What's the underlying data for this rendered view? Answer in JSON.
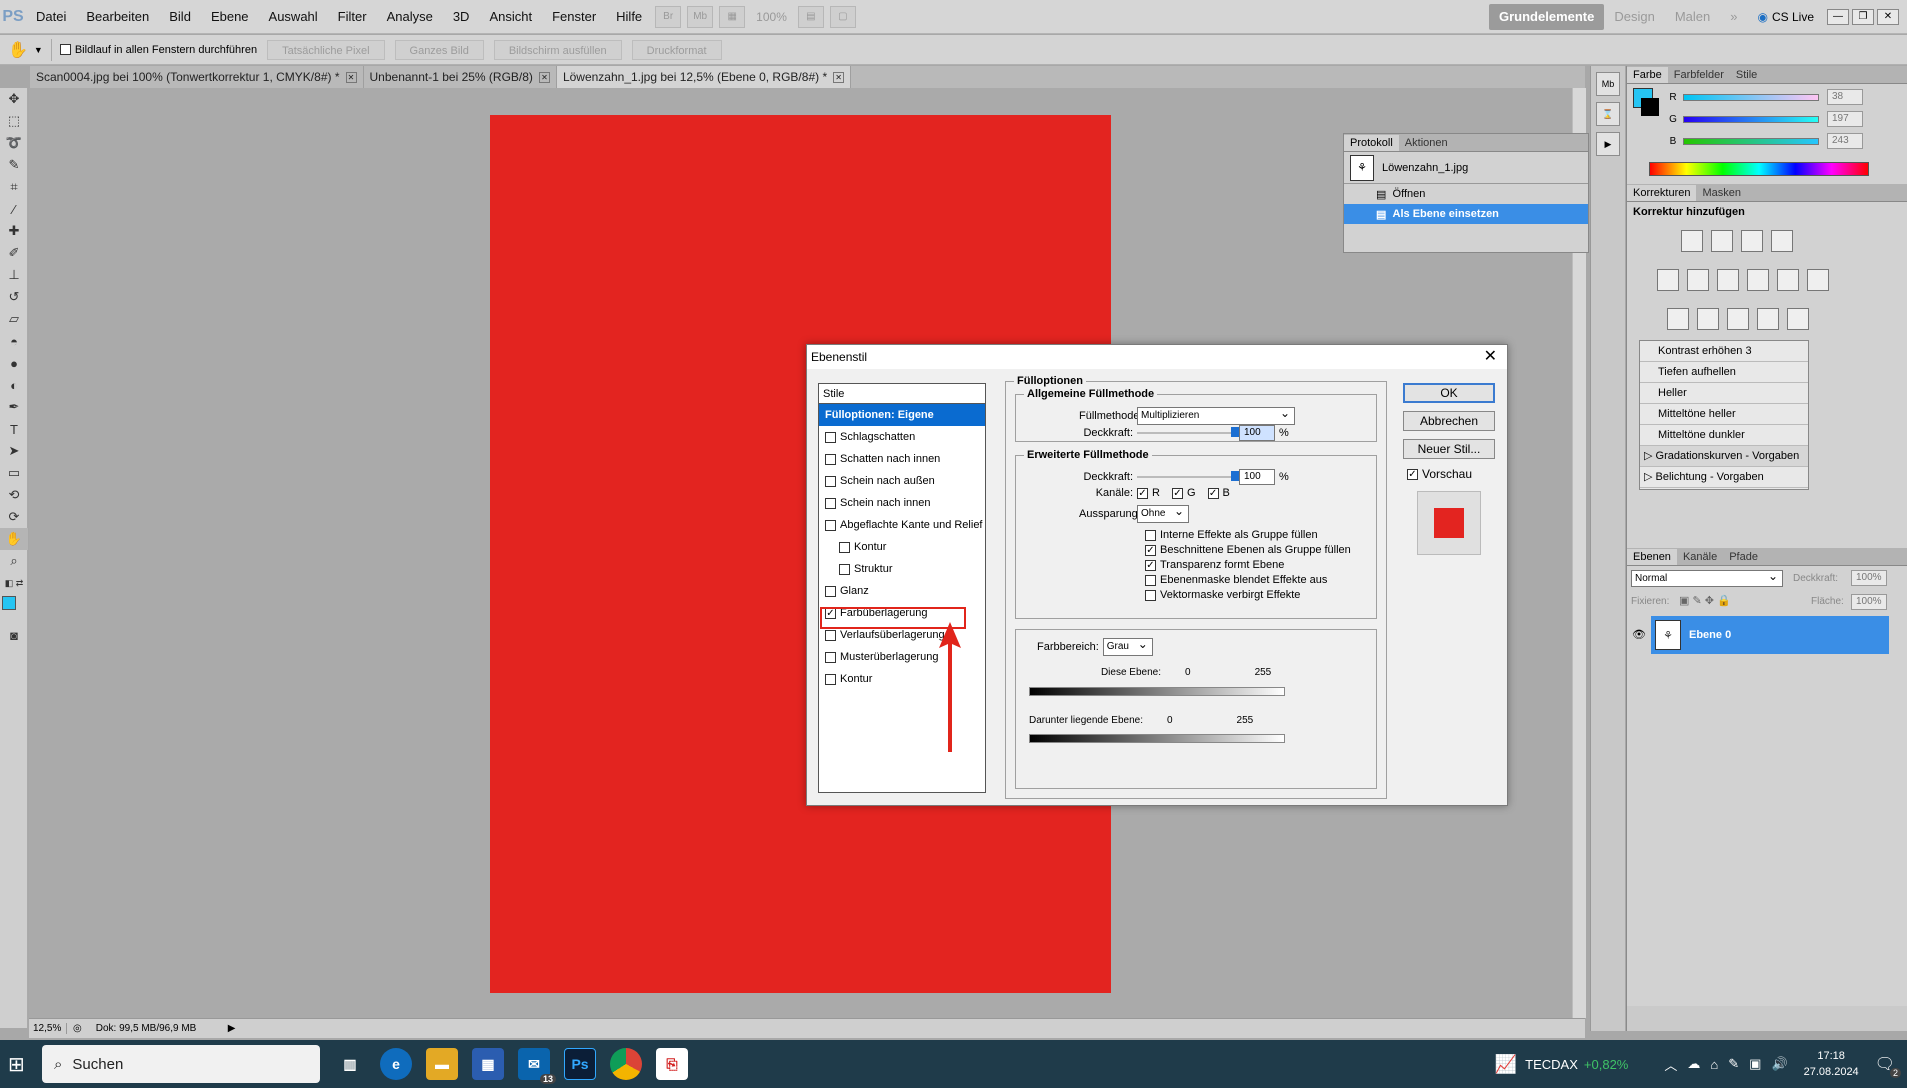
{
  "menubar": {
    "logo": "PS",
    "items": [
      "Datei",
      "Bearbeiten",
      "Bild",
      "Ebene",
      "Auswahl",
      "Filter",
      "Analyse",
      "3D",
      "Ansicht",
      "Fenster",
      "Hilfe"
    ],
    "bridge_labels": [
      "Br",
      "Mb"
    ],
    "zoom": "100%",
    "workspaces": [
      "Grundelemente",
      "Design",
      "Malen"
    ],
    "more": "»",
    "cslive": "CS Live"
  },
  "options": {
    "scroll_all_label": "Bildlauf in allen Fenstern durchführen",
    "buttons": [
      "Tatsächliche Pixel",
      "Ganzes Bild",
      "Bildschirm ausfüllen",
      "Druckformat"
    ]
  },
  "tabs": [
    {
      "label": "Scan0004.jpg bei 100% (Tonwertkorrektur 1, CMYK/8#) *",
      "active": false
    },
    {
      "label": "Unbenannt-1 bei 25% (RGB/8)",
      "active": false
    },
    {
      "label": "Löwenzahn_1.jpg bei 12,5% (Ebene 0, RGB/8#) *",
      "active": true
    }
  ],
  "document": {
    "fill_color": "#e32420"
  },
  "status": {
    "zoom": "12,5%",
    "doc_info": "Dok: 99,5 MB/96,9 MB"
  },
  "history": {
    "tabs": [
      "Protokoll",
      "Aktionen"
    ],
    "snapshot": "Löwenzahn_1.jpg",
    "items": [
      {
        "label": "Öffnen",
        "selected": false
      },
      {
        "label": "Als Ebene einsetzen",
        "selected": true
      }
    ]
  },
  "color_panel": {
    "tabs": [
      "Farbe",
      "Farbfelder",
      "Stile"
    ],
    "channels": [
      {
        "label": "R",
        "value": "38"
      },
      {
        "label": "G",
        "value": "197"
      },
      {
        "label": "B",
        "value": "243"
      }
    ],
    "fg_color": "#26c5f3"
  },
  "adjust_panel": {
    "tabs": [
      "Korrekturen",
      "Masken"
    ],
    "title": "Korrektur hinzufügen",
    "presets": [
      "Kontrast erhöhen 3",
      "Tiefen aufhellen",
      "Heller",
      "Mitteltöne heller",
      "Mitteltöne dunkler",
      "Gradationskurven - Vorgaben",
      "Belichtung - Vorgaben"
    ]
  },
  "layers_panel": {
    "tabs": [
      "Ebenen",
      "Kanäle",
      "Pfade"
    ],
    "blend": "Normal",
    "opacity_label": "Deckkraft:",
    "opacity": "100%",
    "lock_label": "Fixieren:",
    "fill_label": "Fläche:",
    "fill": "100%",
    "layer_name": "Ebene 0"
  },
  "dialog": {
    "title": "Ebenenstil",
    "close": "✕",
    "styles_header": "Stile",
    "styles": [
      {
        "label": "Fülloptionen: Eigene",
        "selected": true,
        "checkbox": false,
        "checked": false,
        "sub": false
      },
      {
        "label": "Schlagschatten",
        "selected": false,
        "checkbox": true,
        "checked": false,
        "sub": false
      },
      {
        "label": "Schatten nach innen",
        "selected": false,
        "checkbox": true,
        "checked": false,
        "sub": false
      },
      {
        "label": "Schein nach außen",
        "selected": false,
        "checkbox": true,
        "checked": false,
        "sub": false
      },
      {
        "label": "Schein nach innen",
        "selected": false,
        "checkbox": true,
        "checked": false,
        "sub": false
      },
      {
        "label": "Abgeflachte Kante und Relief",
        "selected": false,
        "checkbox": true,
        "checked": false,
        "sub": false
      },
      {
        "label": "Kontur",
        "selected": false,
        "checkbox": true,
        "checked": false,
        "sub": true
      },
      {
        "label": "Struktur",
        "selected": false,
        "checkbox": true,
        "checked": false,
        "sub": true
      },
      {
        "label": "Glanz",
        "selected": false,
        "checkbox": true,
        "checked": false,
        "sub": false
      },
      {
        "label": "Farbüberlagerung",
        "selected": false,
        "checkbox": true,
        "checked": true,
        "sub": false
      },
      {
        "label": "Verlaufsüberlagerung",
        "selected": false,
        "checkbox": true,
        "checked": false,
        "sub": false
      },
      {
        "label": "Musterüberlagerung",
        "selected": false,
        "checkbox": true,
        "checked": false,
        "sub": false
      },
      {
        "label": "Kontur",
        "selected": false,
        "checkbox": true,
        "checked": false,
        "sub": false
      }
    ],
    "fill_options_title": "Fülloptionen",
    "general": {
      "title": "Allgemeine Füllmethode",
      "blend_label": "Füllmethode:",
      "blend_value": "Multiplizieren",
      "opacity_label": "Deckkraft:",
      "opacity_value": "100",
      "unit": "%"
    },
    "advanced": {
      "title": "Erweiterte Füllmethode",
      "opacity_label": "Deckkraft:",
      "opacity_value": "100",
      "unit": "%",
      "channels_label": "Kanäle:",
      "channels": [
        "R",
        "G",
        "B"
      ],
      "knockout_label": "Aussparung:",
      "knockout_value": "Ohne",
      "options": [
        {
          "label": "Interne Effekte als Gruppe füllen",
          "checked": false
        },
        {
          "label": "Beschnittene Ebenen als Gruppe füllen",
          "checked": true
        },
        {
          "label": "Transparenz formt Ebene",
          "checked": true
        },
        {
          "label": "Ebenenmaske blendet Effekte aus",
          "checked": false
        },
        {
          "label": "Vektormaske verbirgt Effekte",
          "checked": false
        }
      ]
    },
    "blendif": {
      "label": "Farbbereich:",
      "value": "Grau",
      "this_layer": "Diese Ebene:",
      "underlying": "Darunter liegende Ebene:",
      "min": "0",
      "max": "255"
    },
    "buttons": {
      "ok": "OK",
      "cancel": "Abbrechen",
      "new_style": "Neuer Stil...",
      "preview": "Vorschau"
    },
    "preview_color": "#e32420"
  },
  "taskbar": {
    "search": "Suchen",
    "mail_badge": "13",
    "ps_label": "Ps",
    "stock_name": "TECDAX",
    "stock_change": "+0,82%",
    "time": "17:18",
    "date": "27.08.2024",
    "notif": "2"
  }
}
